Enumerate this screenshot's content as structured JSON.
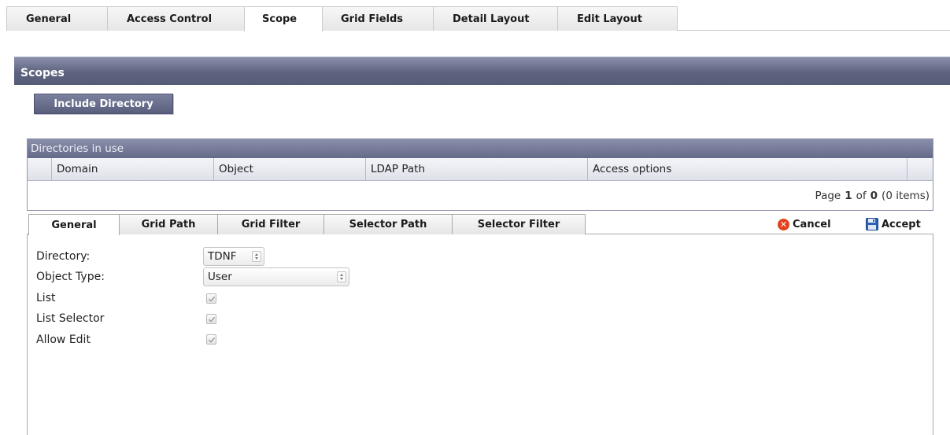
{
  "top_tabs": [
    {
      "label": "General",
      "active": false
    },
    {
      "label": "Access Control",
      "active": false
    },
    {
      "label": "Scope",
      "active": true
    },
    {
      "label": "Grid Fields",
      "active": false
    },
    {
      "label": "Detail Layout",
      "active": false
    },
    {
      "label": "Edit Layout",
      "active": false
    }
  ],
  "scopes": {
    "title": "Scopes",
    "include_button": "Include Directory"
  },
  "directories": {
    "title": "Directories in use",
    "columns": [
      "Domain",
      "Object",
      "LDAP Path",
      "Access options"
    ],
    "rows": [],
    "pager": {
      "prefix": "Page",
      "page": "1",
      "of": "of",
      "total": "0",
      "items": "(0 items)"
    }
  },
  "inner_tabs": [
    {
      "label": "General",
      "active": true
    },
    {
      "label": "Grid Path",
      "active": false
    },
    {
      "label": "Grid Filter",
      "active": false
    },
    {
      "label": "Selector Path",
      "active": false
    },
    {
      "label": "Selector Filter",
      "active": false
    }
  ],
  "actions": {
    "cancel": "Cancel",
    "accept": "Accept",
    "cancel_icon": "cancel-icon",
    "accept_icon": "floppy-disk-icon"
  },
  "form": {
    "directory_label": "Directory:",
    "directory_value": "TDNF",
    "object_type_label": "Object Type:",
    "object_type_value": "User",
    "list_label": "List",
    "list_checked": true,
    "list_selector_label": "List Selector",
    "list_selector_checked": true,
    "allow_edit_label": "Allow Edit",
    "allow_edit_checked": true
  },
  "colors": {
    "header": "#5d637f",
    "cancel_icon": "#e0421c",
    "accept_icon": "#2a63b5"
  }
}
